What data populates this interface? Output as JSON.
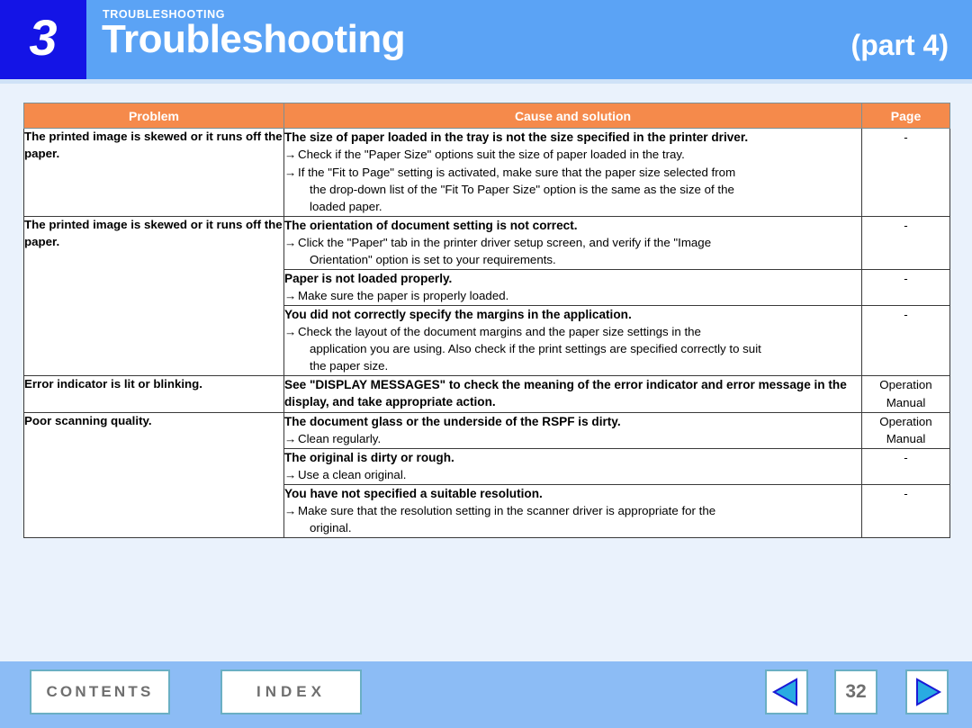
{
  "header": {
    "chapter_number": "3",
    "kicker": "TROUBLESHOOTING",
    "title": "Troubleshooting",
    "part_label": "(part 4)",
    "badge_color": "#1414e6",
    "banner_color": "#5ba3f5"
  },
  "table": {
    "accent_color": "#f58a4b",
    "columns": [
      "Problem",
      "Cause and solution",
      "Page"
    ],
    "rows": [
      {
        "problem": "The printed image is skewed or it runs off the paper.",
        "problem_rowspan": 1,
        "causes": [
          {
            "heading": "The size of paper loaded in the tray is not the size specified in the printer driver.",
            "steps": [
              [
                "Check if the \"Paper Size\" options suit the size of paper loaded in the tray."
              ],
              [
                "If the \"Fit to Page\" setting is activated, make sure that the paper size selected from",
                "the drop-down list of the \"Fit To Paper Size\" option is the same as the size of the",
                "loaded paper."
              ]
            ],
            "page": "-"
          }
        ]
      },
      {
        "problem": "The printed image is skewed or it runs off the paper.",
        "problem_rowspan": 3,
        "causes": [
          {
            "heading": "The orientation of document setting is not correct.",
            "steps": [
              [
                "Click the \"Paper\" tab in the printer driver setup screen, and verify if the \"Image",
                "Orientation\" option is set to your requirements."
              ]
            ],
            "page": "-"
          },
          {
            "heading": "Paper is not loaded properly.",
            "steps": [
              [
                "Make sure the paper is properly loaded."
              ]
            ],
            "page": "-"
          },
          {
            "heading": "You did not correctly specify the margins in the application.",
            "steps": [
              [
                "Check the layout of the document margins and the paper size settings in the",
                "application you are using. Also check if the print settings are specified correctly to suit",
                "the paper size."
              ]
            ],
            "page": "-"
          }
        ]
      },
      {
        "problem": "Error indicator is lit or blinking.",
        "problem_rowspan": 1,
        "causes": [
          {
            "heading": "See \"DISPLAY MESSAGES\" to check the meaning of the error indicator and error message in the display, and take appropriate action.",
            "steps": [],
            "page": "Operation Manual"
          }
        ]
      },
      {
        "problem": "Poor scanning quality.",
        "problem_rowspan": 3,
        "causes": [
          {
            "heading": "The document glass or the underside of the RSPF is dirty.",
            "steps": [
              [
                "Clean regularly."
              ]
            ],
            "page": "Operation Manual"
          },
          {
            "heading": "The original is dirty or rough.",
            "steps": [
              [
                "Use a clean original."
              ]
            ],
            "page": "-"
          },
          {
            "heading": "You have not specified a suitable resolution.",
            "steps": [
              [
                "Make sure that the resolution setting in the scanner driver is appropriate for the",
                "original."
              ]
            ],
            "page": "-"
          }
        ]
      }
    ],
    "step_arrow": "→"
  },
  "footer": {
    "contents_label": "CONTENTS",
    "index_label": "INDEX",
    "page_number": "32",
    "prev_icon": "left-triangle-icon",
    "next_icon": "right-triangle-icon",
    "background_color": "#8cbcf5"
  }
}
